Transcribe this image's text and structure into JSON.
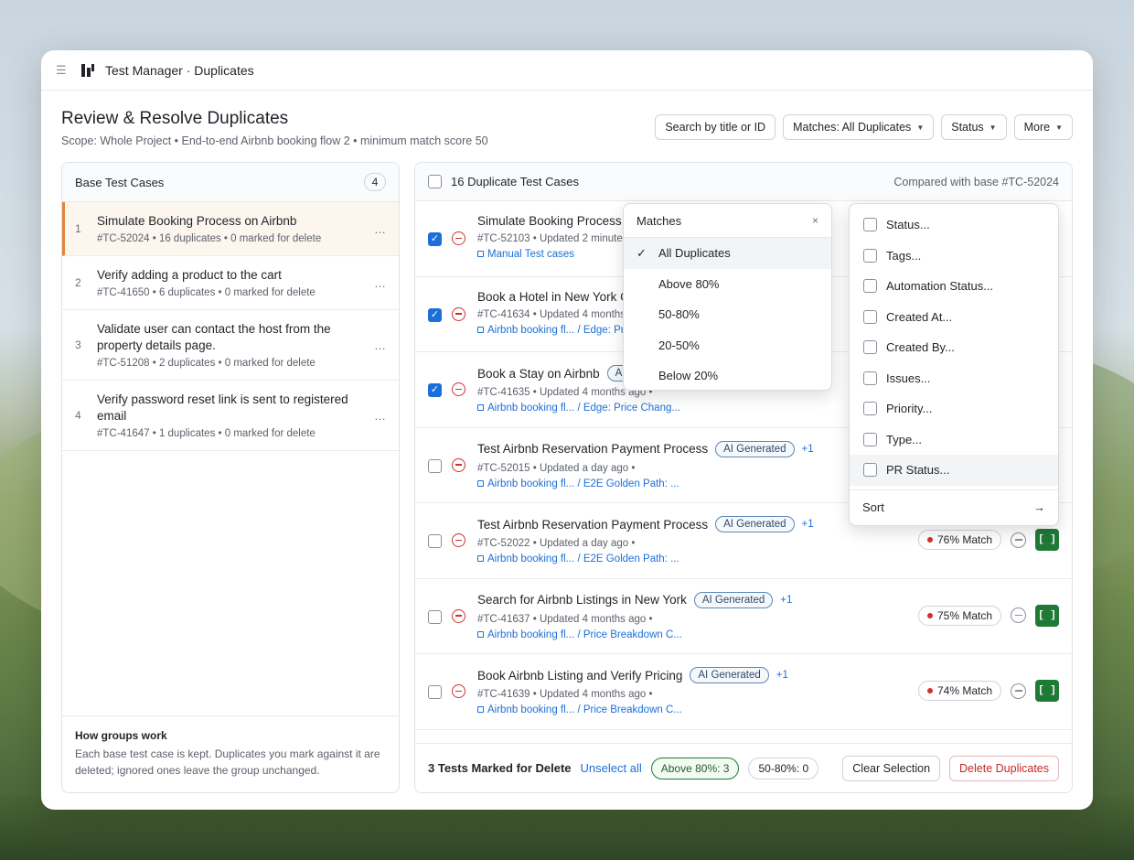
{
  "app": {
    "title": "Test Manager · Duplicates"
  },
  "page": {
    "title": "Review & Resolve Duplicates",
    "subtitle": "Scope: Whole Project • End-to-end Airbnb booking flow 2 • minimum match score 50"
  },
  "toolbar": {
    "search_label": "Search by title or ID",
    "matches_label": "Matches: All Duplicates",
    "status_label": "Status",
    "more_label": "More"
  },
  "base_panel": {
    "title": "Base Test Cases",
    "count": "4",
    "items": [
      {
        "num": "1",
        "title": "Simulate Booking Process on Airbnb",
        "meta": "#TC-52024 • 16 duplicates • 0 marked for delete"
      },
      {
        "num": "2",
        "title": "Verify adding a product to the cart",
        "meta": "#TC-41650 • 6 duplicates • 0 marked for delete"
      },
      {
        "num": "3",
        "title": "Validate user can contact the host from the property details page.",
        "meta": "#TC-51208 • 2 duplicates • 0 marked for delete"
      },
      {
        "num": "4",
        "title": "Verify password reset link is sent to registered email",
        "meta": "#TC-41647 • 1 duplicates • 0 marked for delete"
      }
    ],
    "more_glyph": "…",
    "footer_title": "How groups work",
    "footer_text": "Each base test case is kept. Duplicates you mark against it are deleted; ignored ones leave the group unchanged."
  },
  "dup_panel": {
    "title": "16 Duplicate Test Cases",
    "compared": "Compared with base #TC-52024",
    "ai_label": "AI Generated",
    "green_btn": "[ ]",
    "rows": [
      {
        "title": "Simulate Booking Process o",
        "meta": "#TC-52103 • Updated 2 minute",
        "path": "Manual Test cases"
      },
      {
        "title": "Book a Hotel in New York C",
        "meta": "#TC-41634 • Updated 4 months",
        "path": "Airbnb booking fl... / Edge: Pri"
      },
      {
        "title": "Book a Stay on Airbnb",
        "ai": "AI",
        "meta": "#TC-41635 • Updated 4 months ago •",
        "path": "Airbnb booking fl... / Edge: Price Chang..."
      },
      {
        "title": "Test Airbnb Reservation Payment Process",
        "ai": "AI Generated",
        "plus": "+1",
        "meta": "#TC-52015 • Updated a day ago •",
        "path": "Airbnb booking fl... / E2E Golden Path: ..."
      },
      {
        "title": "Test Airbnb Reservation Payment Process",
        "ai": "AI Generated",
        "plus": "+1",
        "meta": "#TC-52022 • Updated a day ago •",
        "path": "Airbnb booking fl... / E2E Golden Path: ...",
        "match": "76% Match"
      },
      {
        "title": "Search for Airbnb Listings in New York",
        "ai": "AI Generated",
        "plus": "+1",
        "meta": "#TC-41637 • Updated 4 months ago •",
        "path": "Airbnb booking fl... / Price Breakdown C...",
        "match": "75% Match"
      },
      {
        "title": "Book Airbnb Listing and Verify Pricing",
        "ai": "AI Generated",
        "plus": "+1",
        "meta": "#TC-41639 • Updated 4 months ago •",
        "path": "Airbnb booking fl... / Price Breakdown C...",
        "match": "74% Match"
      }
    ],
    "footer": {
      "marked": "3 Tests Marked for Delete",
      "unselect": "Unselect all",
      "pill_above": "Above 80%: 3",
      "pill_mid": "50-80%: 0",
      "clear": "Clear Selection",
      "delete": "Delete Duplicates"
    }
  },
  "matches_menu": {
    "title": "Matches",
    "close": "×",
    "check": "✓",
    "items": [
      "All Duplicates",
      "Above 80%",
      "50-80%",
      "20-50%",
      "Below 20%"
    ]
  },
  "filter_menu": {
    "items": [
      "Status...",
      "Tags...",
      "Automation Status...",
      "Created At...",
      "Created By...",
      "Issues...",
      "Priority...",
      "Type...",
      "PR Status..."
    ],
    "sort": "Sort",
    "arrow": "→"
  },
  "colors": {
    "accent": "#1b6fd8",
    "active_border": "#e3843a",
    "danger": "#d12f2f",
    "success": "#1f7a36"
  }
}
